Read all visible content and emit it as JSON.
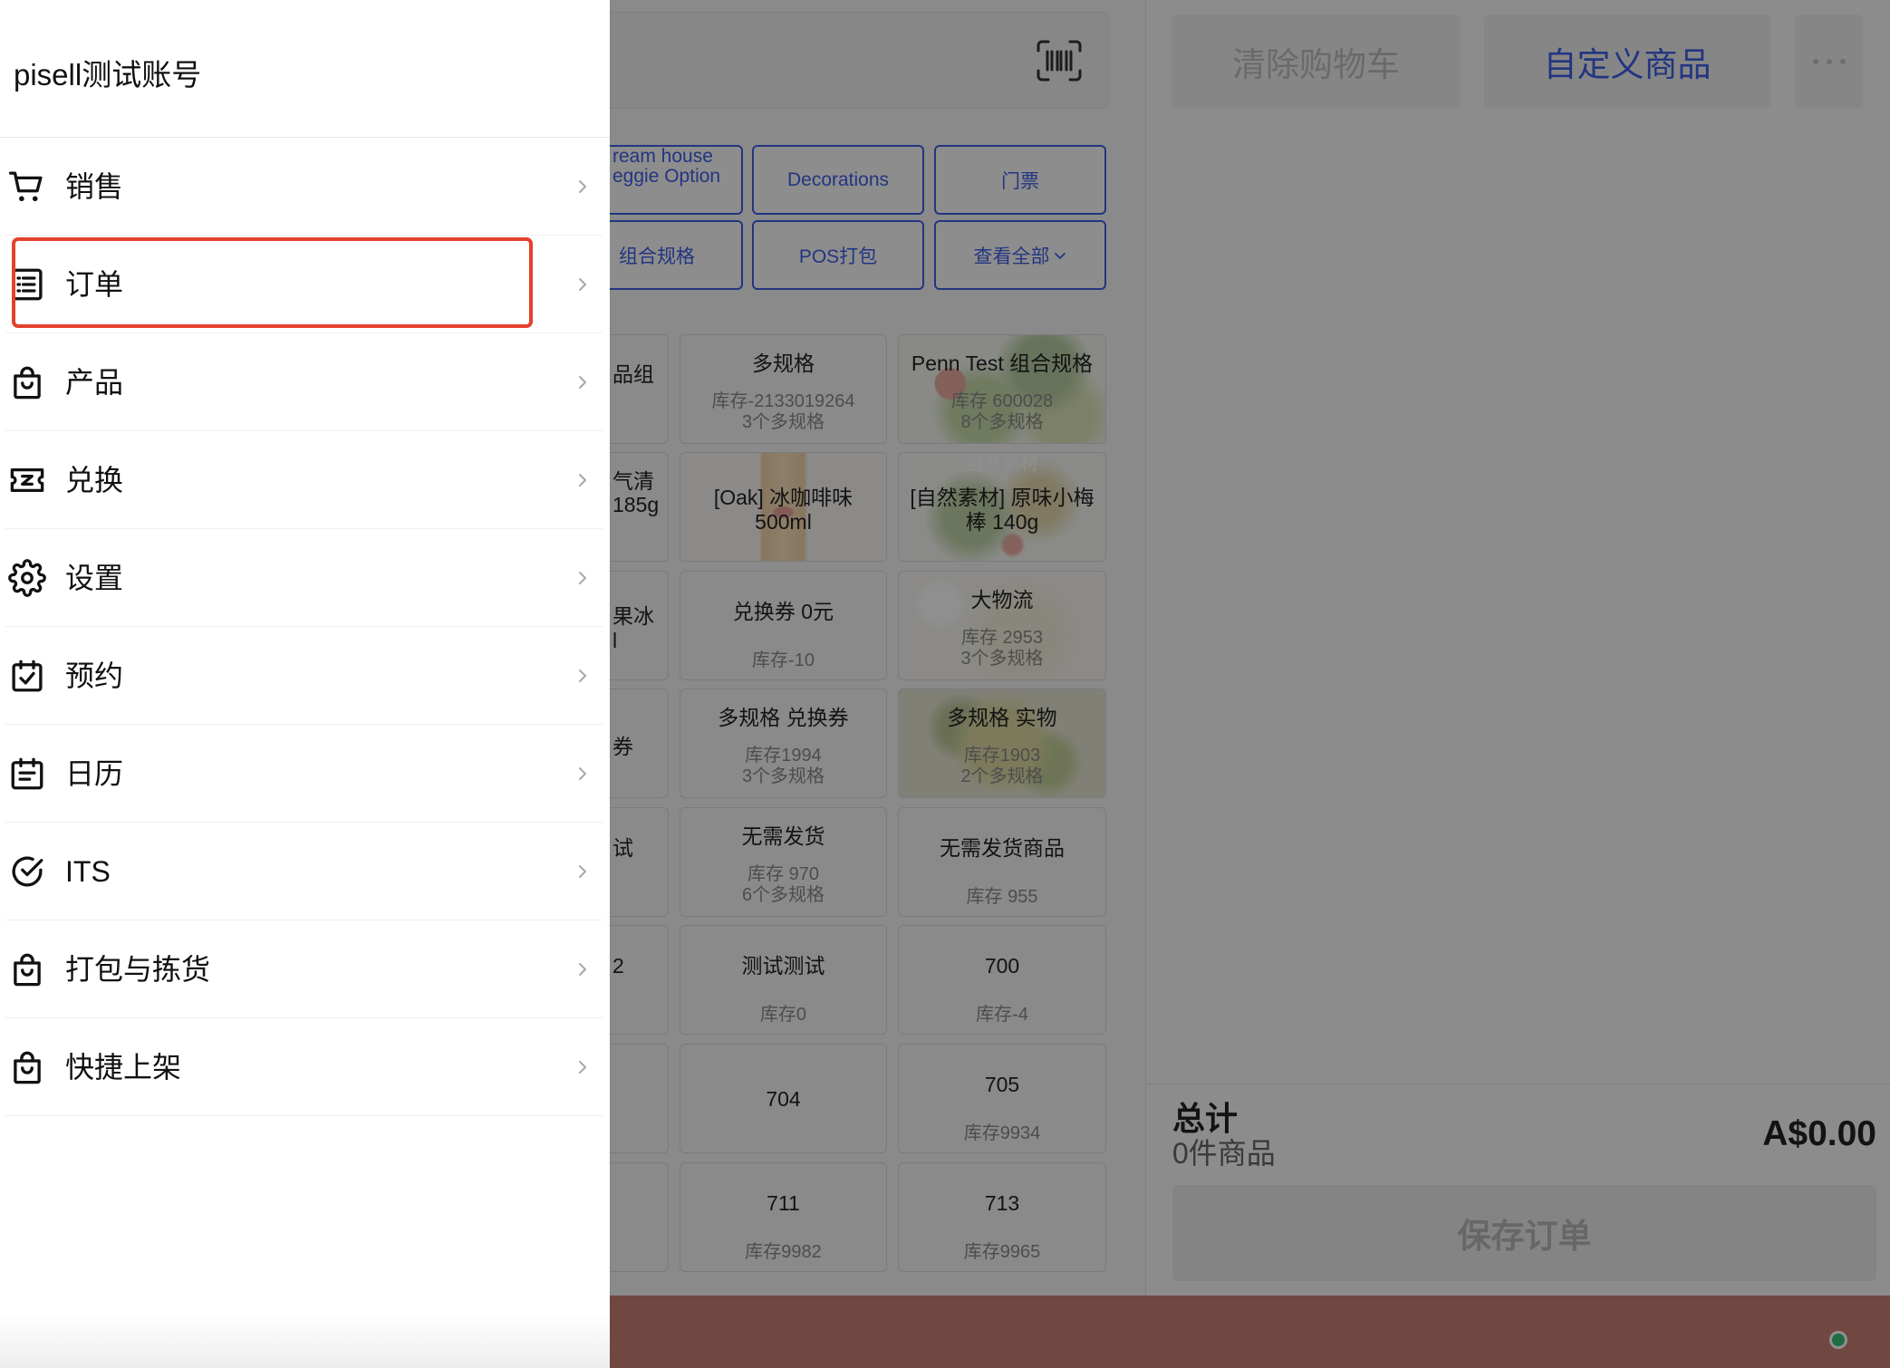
{
  "drawer": {
    "account_name": "pisell测试账号",
    "highlighted_index": 1,
    "items": [
      {
        "label": "销售",
        "icon": "cart-icon"
      },
      {
        "label": "订单",
        "icon": "list-icon"
      },
      {
        "label": "产品",
        "icon": "bag-icon"
      },
      {
        "label": "兑换",
        "icon": "ticket-icon"
      },
      {
        "label": "设置",
        "icon": "gear-icon"
      },
      {
        "label": "预约",
        "icon": "calendar-check-icon"
      },
      {
        "label": "日历",
        "icon": "calendar-icon"
      },
      {
        "label": "ITS",
        "icon": "circle-check-icon"
      },
      {
        "label": "打包与拣货",
        "icon": "bag-icon"
      },
      {
        "label": "快捷上架",
        "icon": "bag-icon"
      }
    ]
  },
  "search": {
    "scan_icon": "barcode-icon"
  },
  "categories": {
    "row1": [
      {
        "lines": [
          "ream house",
          "eggie Option"
        ]
      },
      {
        "label": "Decorations"
      },
      {
        "label": "门票"
      }
    ],
    "row2": [
      {
        "label": "组合规格"
      },
      {
        "label": "POS打包"
      },
      {
        "label": "查看全部",
        "icon": "chevron-down-icon"
      }
    ]
  },
  "partial_column": [
    [
      "品组"
    ],
    [
      "气清",
      "185g"
    ],
    [
      "果冰",
      "l"
    ],
    [
      "券"
    ],
    [
      "试"
    ],
    [
      "2"
    ]
  ],
  "products": [
    {
      "name": "多规格",
      "stock": "库存-2133019264",
      "variants": "3个多规格"
    },
    {
      "name": "Penn Test 组合规格",
      "stock": "库存 600028",
      "variants": "8个多规格"
    },
    {
      "name_lines": [
        "[Oak] 冰咖啡味",
        "500ml"
      ]
    },
    {
      "name_lines": [
        "[自然素材] 原味小梅",
        "棒 140g"
      ],
      "image_watermark": "自然素材"
    },
    {
      "name": "兑换券 0元",
      "stock": "库存-10"
    },
    {
      "name": "大物流",
      "stock": "库存 2953",
      "variants": "3个多规格"
    },
    {
      "name": "多规格 兑换券",
      "stock": "库存1994",
      "variants": "3个多规格"
    },
    {
      "name": "多规格 实物",
      "stock": "库存1903",
      "variants": "2个多规格"
    },
    {
      "name": "无需发货",
      "stock": "库存 970",
      "variants": "6个多规格"
    },
    {
      "name": "无需发货商品",
      "stock": "库存 955"
    },
    {
      "name": "测试测试",
      "stock": "库存0"
    },
    {
      "name": "700",
      "stock": "库存-4"
    },
    {
      "name": "704"
    },
    {
      "name": "705",
      "stock": "库存9934"
    },
    {
      "name": "711",
      "stock": "库存9982"
    },
    {
      "name": "713",
      "stock": "库存9965"
    }
  ],
  "cart": {
    "clear_label": "清除购物车",
    "custom_label": "自定义商品",
    "more_icon": "more-icon",
    "total_label": "总计",
    "item_count": "0件商品",
    "total_amount": "A$0.00",
    "save_label": "保存订单"
  },
  "colors": {
    "accent": "#3f5fe6",
    "highlight": "#e5412e",
    "bottom_bar": "#c97f75",
    "status": "#3cbf7c"
  }
}
